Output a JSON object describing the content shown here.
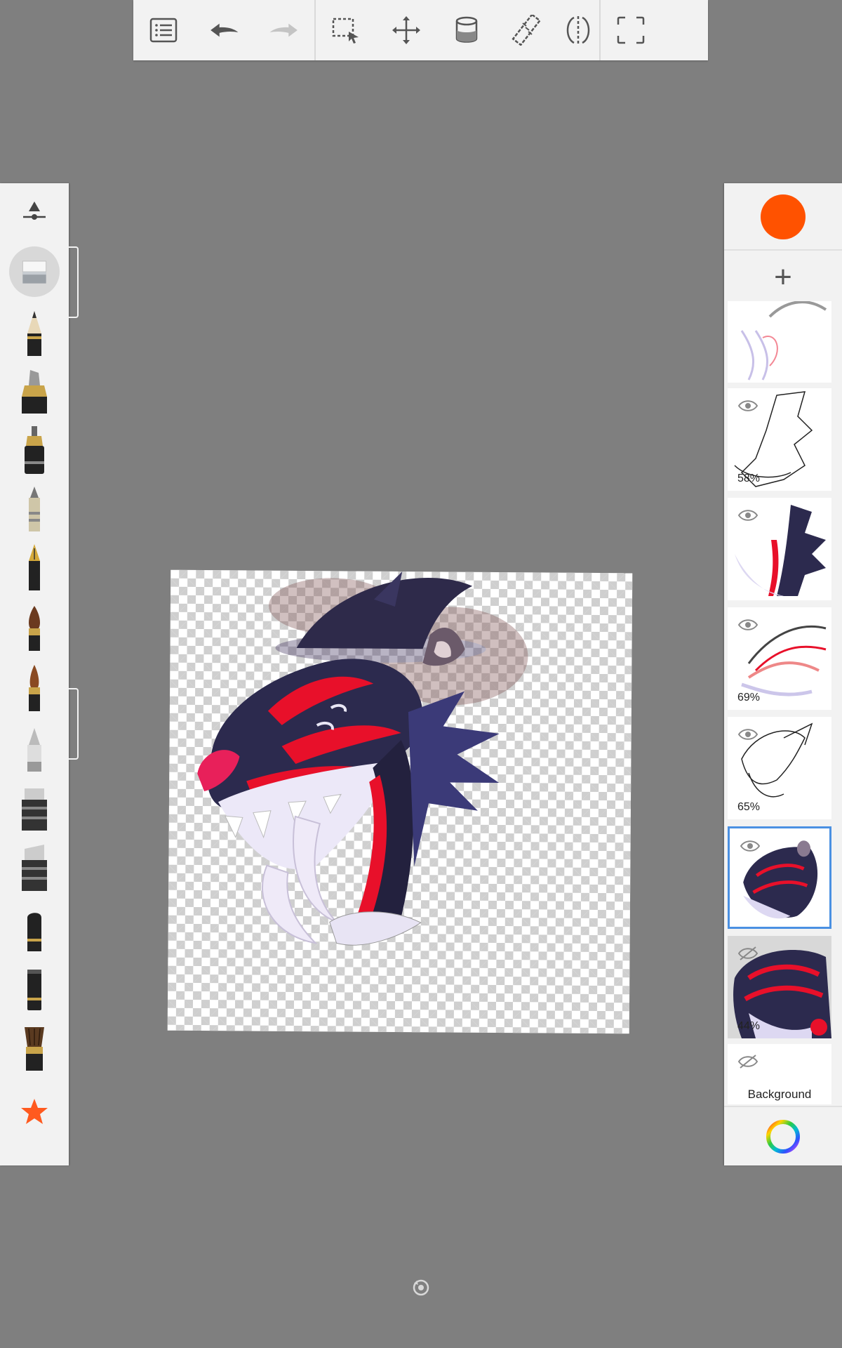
{
  "toolbar": {
    "items": [
      {
        "name": "list-icon"
      },
      {
        "name": "undo-icon"
      },
      {
        "name": "redo-icon"
      },
      {
        "name": "selection-icon"
      },
      {
        "name": "move-icon"
      },
      {
        "name": "fill-bucket-icon"
      },
      {
        "name": "ruler-icon"
      },
      {
        "name": "symmetry-icon"
      },
      {
        "name": "fullscreen-icon"
      }
    ]
  },
  "brushes": {
    "items": [
      "brush-size-icon",
      "eraser-icon",
      "pencil-icon",
      "marker-icon",
      "ink-pen-icon",
      "ballpoint-icon",
      "fountain-pen-icon",
      "round-brush-icon",
      "paint-brush-icon",
      "airbrush-icon",
      "chisel-marker-icon",
      "flat-marker-icon",
      "felt-tip-icon",
      "blender-icon",
      "fan-brush-icon",
      "favorite-star-icon"
    ],
    "active": "eraser-icon"
  },
  "colors": {
    "current": "#ff5200",
    "accent": "#4a90e2",
    "panel": "#f2f2f2",
    "background": "#7f7f7f"
  },
  "layers": {
    "items": [
      {
        "id": "layer-1",
        "opacity": "",
        "visible": true
      },
      {
        "id": "layer-2",
        "opacity": "58%",
        "visible": true
      },
      {
        "id": "layer-3",
        "opacity": "",
        "visible": true
      },
      {
        "id": "layer-4",
        "opacity": "69%",
        "visible": true
      },
      {
        "id": "layer-5",
        "opacity": "65%",
        "visible": true
      },
      {
        "id": "layer-6",
        "opacity": "",
        "visible": true,
        "selected": true
      },
      {
        "id": "layer-7",
        "opacity": "44%",
        "visible": false
      },
      {
        "id": "layer-background",
        "label": "Background",
        "visible": false
      }
    ]
  }
}
